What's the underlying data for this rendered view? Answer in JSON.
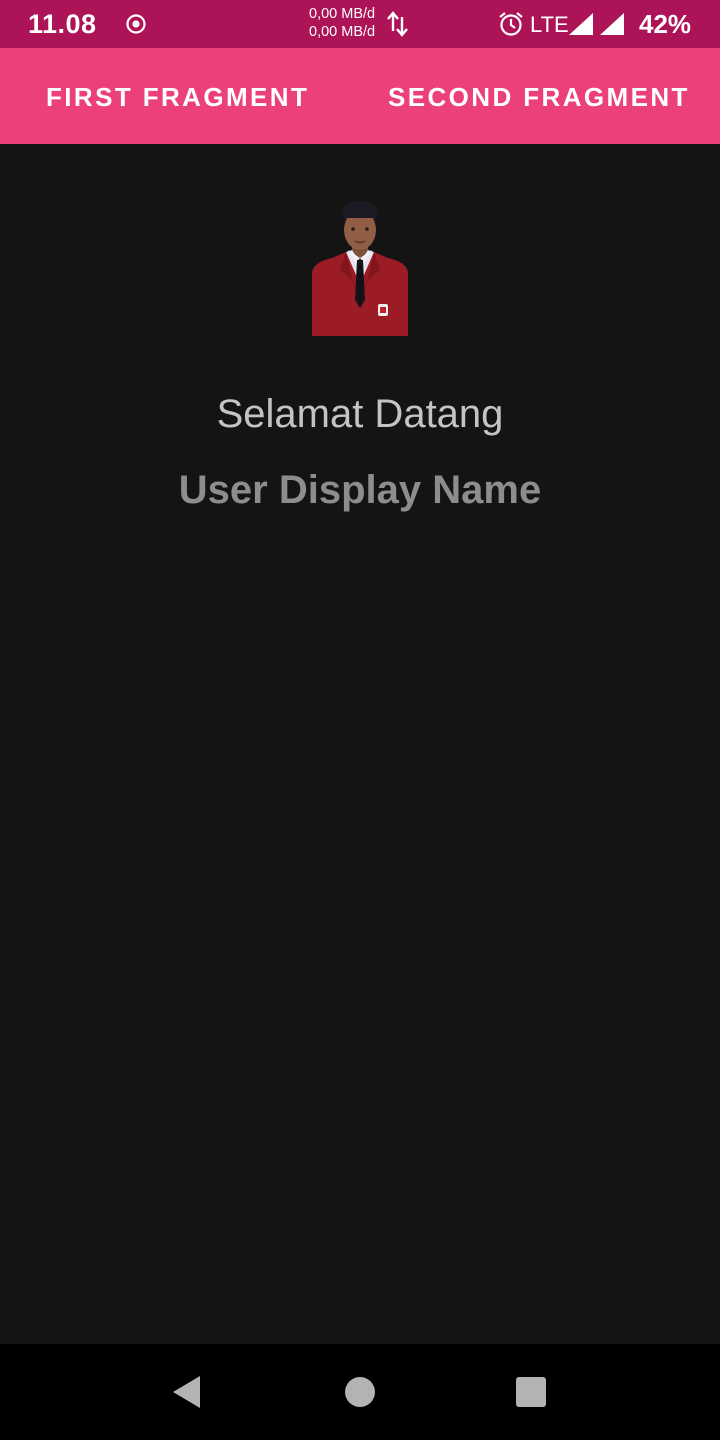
{
  "status_bar": {
    "time": "11.08",
    "upload_speed": "0,00 MB/d",
    "download_speed": "0,00 MB/d",
    "network": "LTE",
    "battery": "42%",
    "icons": [
      "record-icon",
      "data-transfer-icon",
      "alarm-icon",
      "signal-icon",
      "signal-icon"
    ],
    "color": "#ad1457"
  },
  "tabs": [
    {
      "label": "FIRST FRAGMENT"
    },
    {
      "label": "SECOND FRAGMENT"
    }
  ],
  "tab_bar_color": "#ec407a",
  "main": {
    "welcome_text": "Selamat Datang",
    "user_display_name": "User Display Name"
  },
  "nav_bar": {
    "icons": [
      "back-icon",
      "home-icon",
      "recents-icon"
    ]
  }
}
